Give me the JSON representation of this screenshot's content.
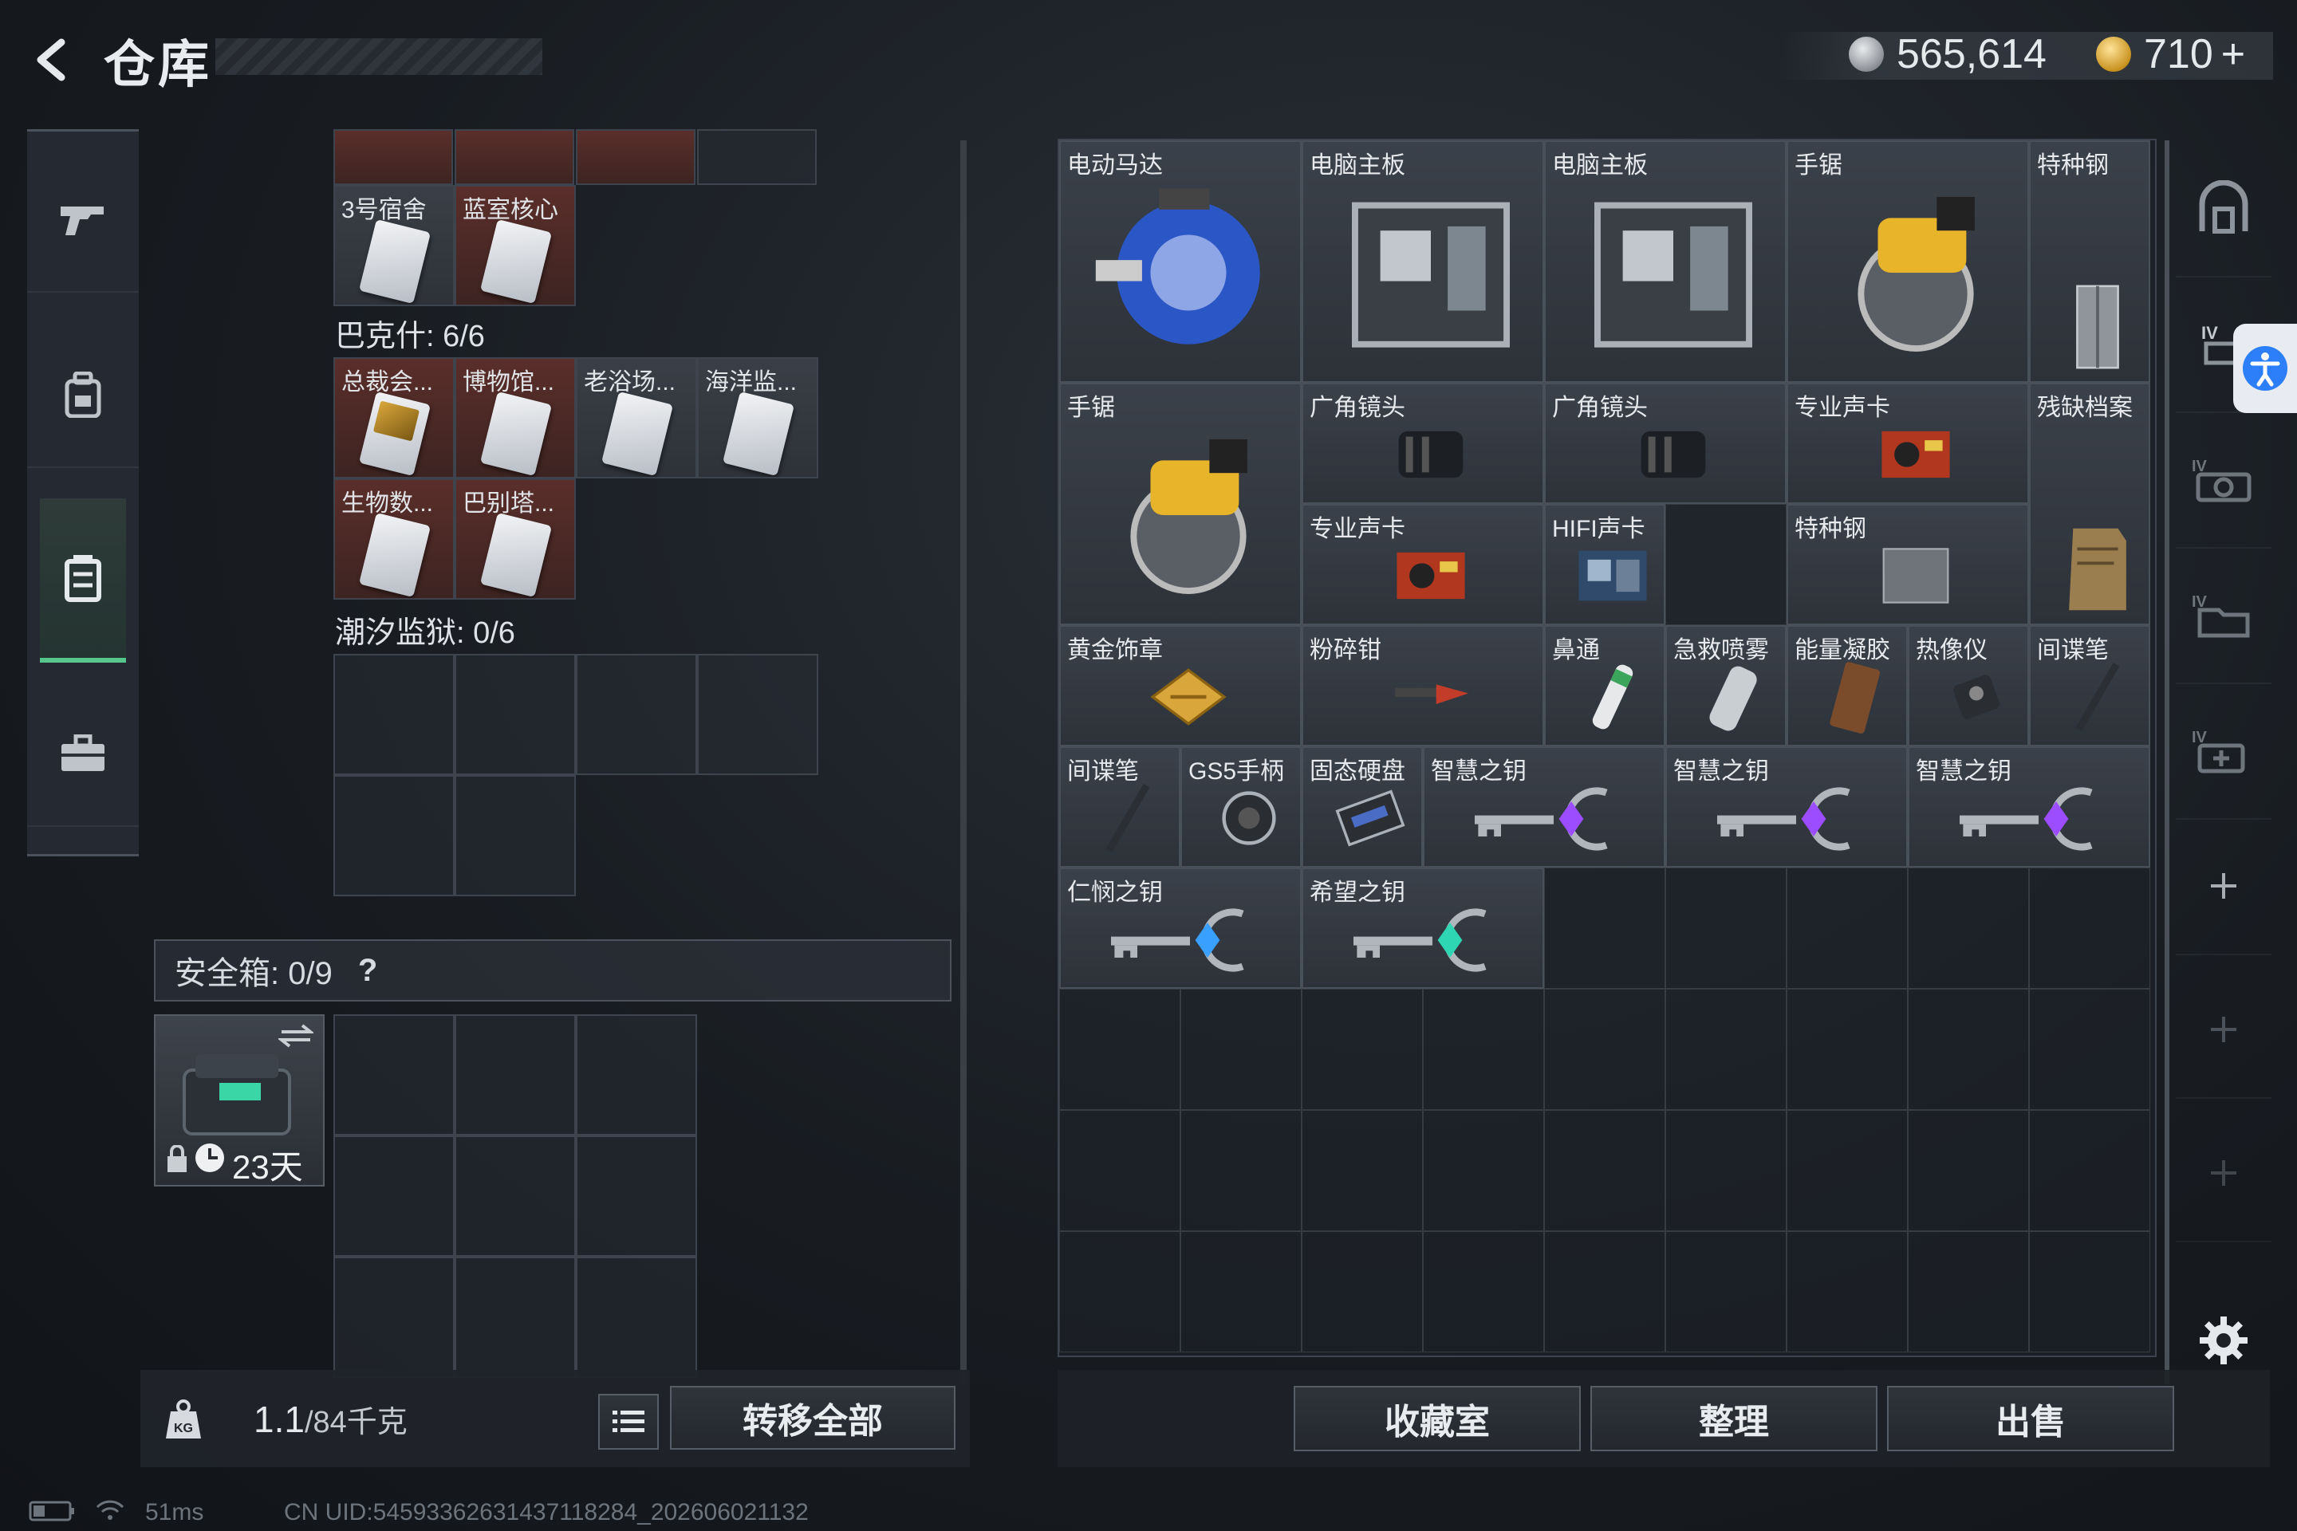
{
  "header": {
    "title": "仓库",
    "currency1": "565,614",
    "currency2": "710",
    "currency2_plus": "+"
  },
  "left_nav": [
    "weapon-icon",
    "backpack-icon",
    "storage-icon",
    "briefcase-icon"
  ],
  "left": {
    "bakeshi_label": "巴克什: 6/6",
    "chaoxi_label": "潮汐监狱: 0/6",
    "top_cards": [
      {
        "label": "3号宿舍",
        "color": "dark"
      },
      {
        "label": "蓝室核心",
        "color": "red"
      }
    ],
    "bakeshi_cards": [
      {
        "label": "总裁会...",
        "color": "red",
        "gold": true
      },
      {
        "label": "博物馆...",
        "color": "red"
      },
      {
        "label": "老浴场...",
        "color": "dark"
      },
      {
        "label": "海洋监...",
        "color": "dark"
      },
      {
        "label": "生物数...",
        "color": "red"
      },
      {
        "label": "巴别塔...",
        "color": "red"
      }
    ],
    "safe_label": "安全箱: 0/9",
    "safe_help": "?",
    "safe_days": "23天",
    "weight_value": "1.1",
    "weight_total": "/84千克",
    "transfer_all": "转移全部"
  },
  "right": {
    "items": [
      {
        "label": "电动马达",
        "icon": "motor"
      },
      {
        "label": "电脑主板",
        "icon": "motherboard"
      },
      {
        "label": "电脑主板",
        "icon": "motherboard"
      },
      {
        "label": "手锯",
        "icon": "saw"
      },
      {
        "label": "特种钢",
        "icon": "steel"
      },
      {
        "label": "手锯",
        "icon": "saw"
      },
      {
        "label": "广角镜头",
        "icon": "lens"
      },
      {
        "label": "广角镜头",
        "icon": "lens"
      },
      {
        "label": "专业声卡",
        "icon": "card"
      },
      {
        "label": "残缺档案",
        "icon": "file"
      },
      {
        "label": "专业声卡",
        "icon": "card"
      },
      {
        "label": "HIFI声卡",
        "icon": "hifi"
      },
      {
        "label": "特种钢",
        "icon": "steel-flat"
      },
      {
        "label": "黄金饰章",
        "icon": "badge"
      },
      {
        "label": "粉碎钳",
        "icon": "pliers"
      },
      {
        "label": "鼻通",
        "icon": "inhaler"
      },
      {
        "label": "急救喷雾",
        "icon": "spray"
      },
      {
        "label": "能量凝胶",
        "icon": "gel"
      },
      {
        "label": "热像仪",
        "icon": "thermal"
      },
      {
        "label": "间谍笔",
        "icon": "pen"
      },
      {
        "label": "间谍笔",
        "icon": "pen"
      },
      {
        "label": "GS5手柄",
        "icon": "controller"
      },
      {
        "label": "固态硬盘",
        "icon": "ssd"
      },
      {
        "label": "智慧之钥",
        "icon": "key-purple"
      },
      {
        "label": "智慧之钥",
        "icon": "key-purple"
      },
      {
        "label": "智慧之钥",
        "icon": "key-purple"
      },
      {
        "label": "仁悯之钥",
        "icon": "key-blue"
      },
      {
        "label": "希望之钥",
        "icon": "key-teal"
      }
    ],
    "btn_collection": "收藏室",
    "btn_sort": "整理",
    "btn_sell": "出售"
  },
  "status": {
    "ping": "51ms",
    "uid": "CN UID:5459336263143711828​4_202606021132"
  },
  "colors": {
    "accent_green": "#57c68d",
    "key_purple": "#9b4dff",
    "key_blue": "#3aa0ff",
    "key_teal": "#2fd6b4",
    "access_blue": "#2d7ff9"
  }
}
